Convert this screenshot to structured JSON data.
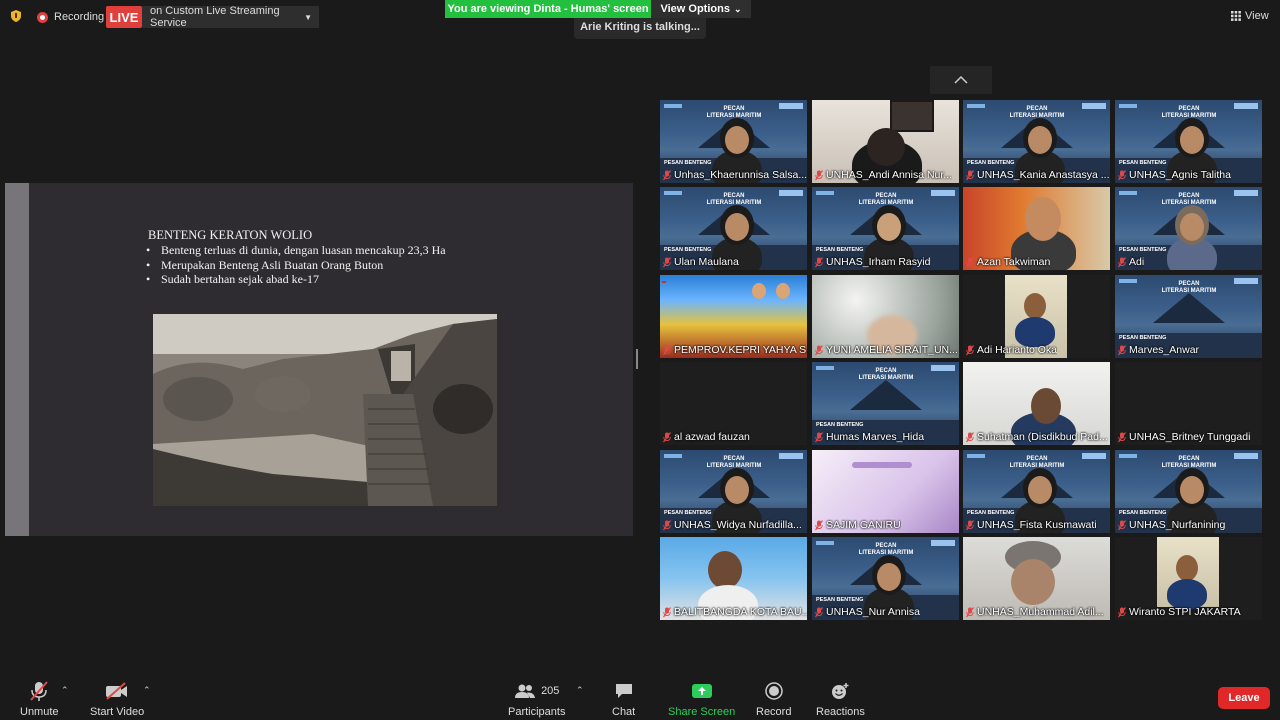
{
  "top": {
    "recording_label": "Recording",
    "live_badge": "LIVE",
    "stream_label": "on Custom Live Streaming Service",
    "viewing_banner": "You are viewing Dinta - Humas' screen",
    "view_options": "View Options",
    "talking": "Arie Kriting is talking...",
    "view_button": "View"
  },
  "slide": {
    "title": "BENTENG KERATON WOLIO",
    "bullets": [
      "Benteng terluas di dunia, dengan luasan mencakup 23,3 Ha",
      "Merupakan Benteng Asli Buatan Orang Buton",
      "Sudah bertahan sejak abad ke-17"
    ]
  },
  "participants": [
    {
      "name": "Unhas_Khaerunnisa Salsa..."
    },
    {
      "name": "UNHAS_Andi Annisa Nur..."
    },
    {
      "name": "UNHAS_Kania Anastasya ..."
    },
    {
      "name": "UNHAS_Agnis Talitha"
    },
    {
      "name": "Ulan Maulana"
    },
    {
      "name": "UNHAS_Irham Rasyid"
    },
    {
      "name": "Azan Takwiman"
    },
    {
      "name": "Adi"
    },
    {
      "name": "PEMPROV.KEPRI YAHYA S..."
    },
    {
      "name": "YUNI AMELIA SIRAIT_UN..."
    },
    {
      "name": "Adi Harianto Oka"
    },
    {
      "name": "Marves_Anwar"
    },
    {
      "name": "al azwad fauzan"
    },
    {
      "name": "Humas Marves_Hida"
    },
    {
      "name": "Suhatman (Disdikbud Pad..."
    },
    {
      "name": "UNHAS_Britney Tunggadi"
    },
    {
      "name": "UNHAS_Widya Nurfadilla..."
    },
    {
      "name": "SAJIM GANIRU"
    },
    {
      "name": "UNHAS_Fista Kusmawati"
    },
    {
      "name": "UNHAS_Nurfanining"
    },
    {
      "name": "BALITBANGDA KOTA BAU..."
    },
    {
      "name": "UNHAS_Nur Annisa"
    },
    {
      "name": "UNHAS_Muhammad Adil..."
    },
    {
      "name": "Wiranto STPI JAKARTA"
    }
  ],
  "poster": {
    "line1": "PECAN",
    "line2": "LITERASI MARITIM",
    "band": "PESAN BENTENG"
  },
  "toolbar": {
    "unmute": "Unmute",
    "start_video": "Start Video",
    "participants": "Participants",
    "participants_count": "205",
    "chat": "Chat",
    "share_screen": "Share Screen",
    "record": "Record",
    "reactions": "Reactions",
    "leave": "Leave"
  },
  "colors": {
    "live": "#e0403c",
    "viewing_banner": "#23c03f",
    "share_screen": "#2dcd5b",
    "leave": "#e02828",
    "muted_mic": "#e04848"
  }
}
